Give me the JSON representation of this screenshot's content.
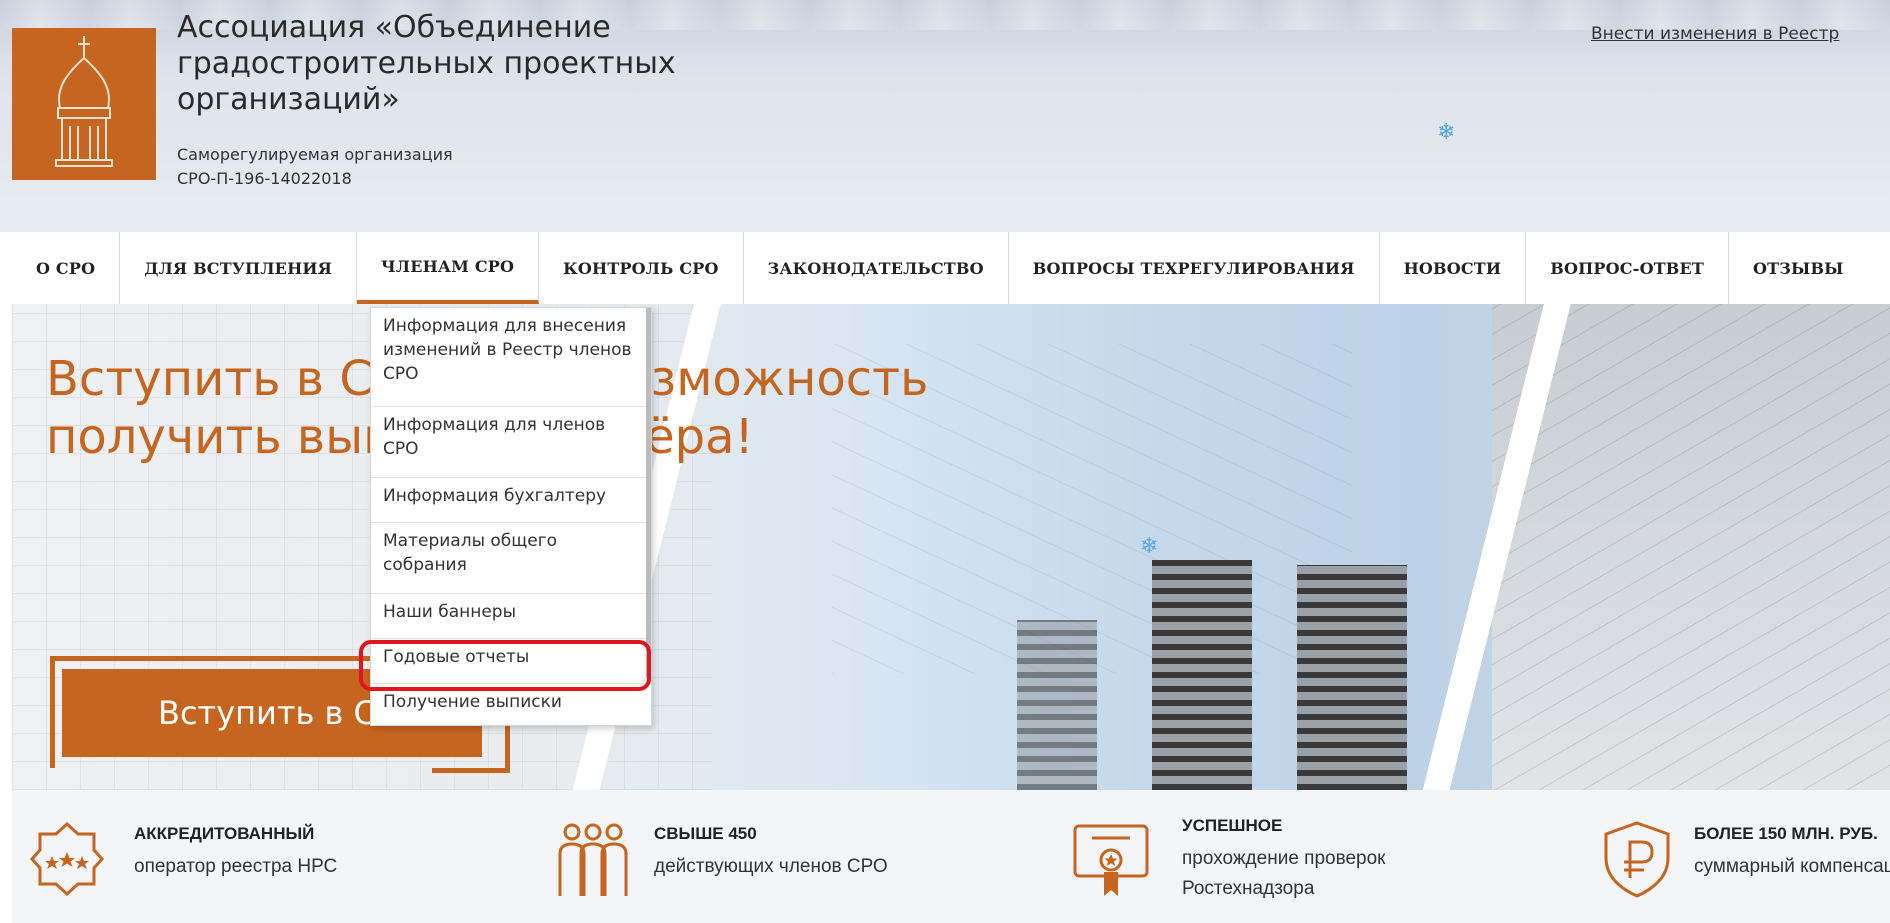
{
  "colors": {
    "accent": "#c6651f",
    "highlight": "#e0151d"
  },
  "header": {
    "title": "Ассоциация «Объединение градостроительных проектных организаций»",
    "subtitle_line1": "Саморегулируемая организация",
    "subtitle_line2": "СРО-П-196-14022018",
    "top_link": "Внести изменения в Реестр",
    "logo_icon": "church-dome-icon",
    "snow_icon": "❄"
  },
  "nav": {
    "items": [
      {
        "label": "О СРО"
      },
      {
        "label": "ДЛЯ ВСТУПЛЕНИЯ"
      },
      {
        "label": "ЧЛЕНАМ СРО",
        "active": true
      },
      {
        "label": "КОНТРОЛЬ СРО"
      },
      {
        "label": "ЗАКОНОДАТЕЛЬСТВО"
      },
      {
        "label": "ВОПРОСЫ ТЕХРЕГУЛИРОВАНИЯ"
      },
      {
        "label": "НОВОСТИ"
      },
      {
        "label": "ВОПРОС-ОТВЕТ"
      },
      {
        "label": "ОТЗЫВЫ"
      }
    ]
  },
  "dropdown": {
    "items": [
      {
        "label": "Информация для внесения изменений в Реестр членов СРО"
      },
      {
        "label": "Информация для членов СРО"
      },
      {
        "label": "Информация бухгалтеру"
      },
      {
        "label": "Материалы общего собрания"
      },
      {
        "label": "Наши баннеры"
      },
      {
        "label": "Годовые отчеты",
        "highlighted": true
      },
      {
        "label": "Получение выписки"
      }
    ]
  },
  "hero": {
    "title": "Вступить в СРО – это возможность получить выгоду партнёра!",
    "cta_label": "Вступить в СРО"
  },
  "features": [
    {
      "icon": "stars-badge-icon",
      "title": "АККРЕДИТОВАННЫЙ",
      "text": "оператор реестра НРС"
    },
    {
      "icon": "people-group-icon",
      "title": "СВЫШЕ 450",
      "text": "действующих членов СРО"
    },
    {
      "icon": "certificate-icon",
      "title": "УСПЕШНОЕ",
      "text": "прохождение проверок Ростехнадзора"
    },
    {
      "icon": "ruble-shield-icon",
      "title": "БОЛЕЕ 150 МЛН. РУБ.",
      "text": "суммарный компенсационный фонд"
    }
  ]
}
